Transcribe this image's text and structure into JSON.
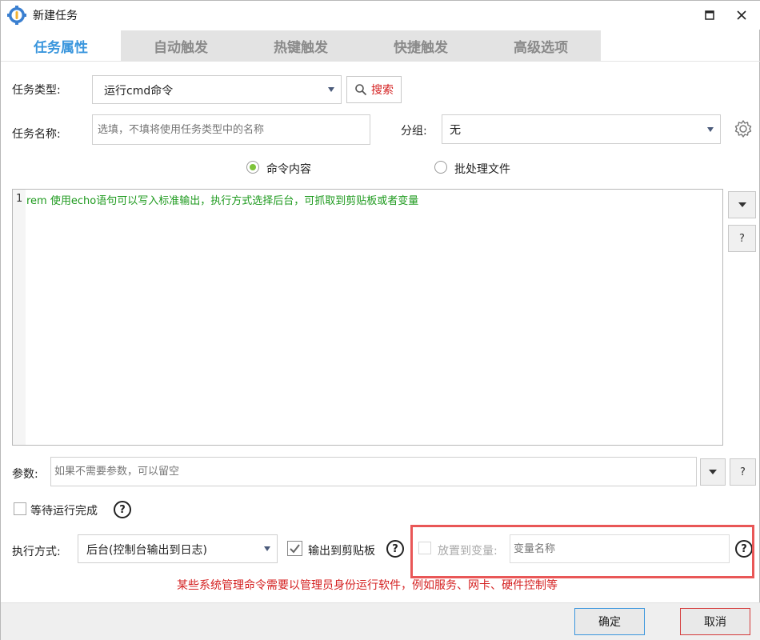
{
  "window": {
    "title": "新建任务"
  },
  "title_buttons": {
    "maximize_glyph": "🗖",
    "close_glyph": "✕"
  },
  "tabs": [
    {
      "label": "任务属性",
      "active": true
    },
    {
      "label": "自动触发",
      "active": false
    },
    {
      "label": "热键触发",
      "active": false
    },
    {
      "label": "快捷触发",
      "active": false
    },
    {
      "label": "高级选项",
      "active": false
    }
  ],
  "task_type": {
    "label": "任务类型:",
    "value": "运行cmd命令"
  },
  "search": {
    "label": "搜索"
  },
  "task_name": {
    "label": "任务名称:",
    "placeholder": "选填，不填将使用任务类型中的名称"
  },
  "group": {
    "label": "分组:",
    "value": "无"
  },
  "source_mode": {
    "options": [
      {
        "label": "命令内容",
        "checked": true
      },
      {
        "label": "批处理文件",
        "checked": false
      }
    ]
  },
  "editor": {
    "lines": [
      {
        "number": "1",
        "text": "rem 使用echo语句可以写入标准输出，执行方式选择后台，可抓取到剪贴板或者变量"
      }
    ]
  },
  "side_buttons": {
    "help": "?"
  },
  "params": {
    "label": "参数:",
    "placeholder": "如果不需要参数，可以留空",
    "help": "?"
  },
  "wait": {
    "label": "等待运行完成",
    "checked": false,
    "help": "?"
  },
  "exec_mode": {
    "label": "执行方式:",
    "value": "后台(控制台输出到日志)"
  },
  "clipboard": {
    "label": "输出到剪贴板",
    "checked": true,
    "help": "?"
  },
  "variable": {
    "label": "放置到变量:",
    "placeholder": "变量名称",
    "checked": false,
    "enabled": false,
    "help": "?"
  },
  "warning": {
    "text": "某些系统管理命令需要以管理员身份运行软件，例如服务、网卡、硬件控制等",
    "color": "#d42020"
  },
  "footer": {
    "ok_label": "确定",
    "cancel_label": "取消"
  },
  "colors": {
    "accent": "#3a96dd",
    "code": "#1e9a1e",
    "highlight_box": "#e95757"
  }
}
